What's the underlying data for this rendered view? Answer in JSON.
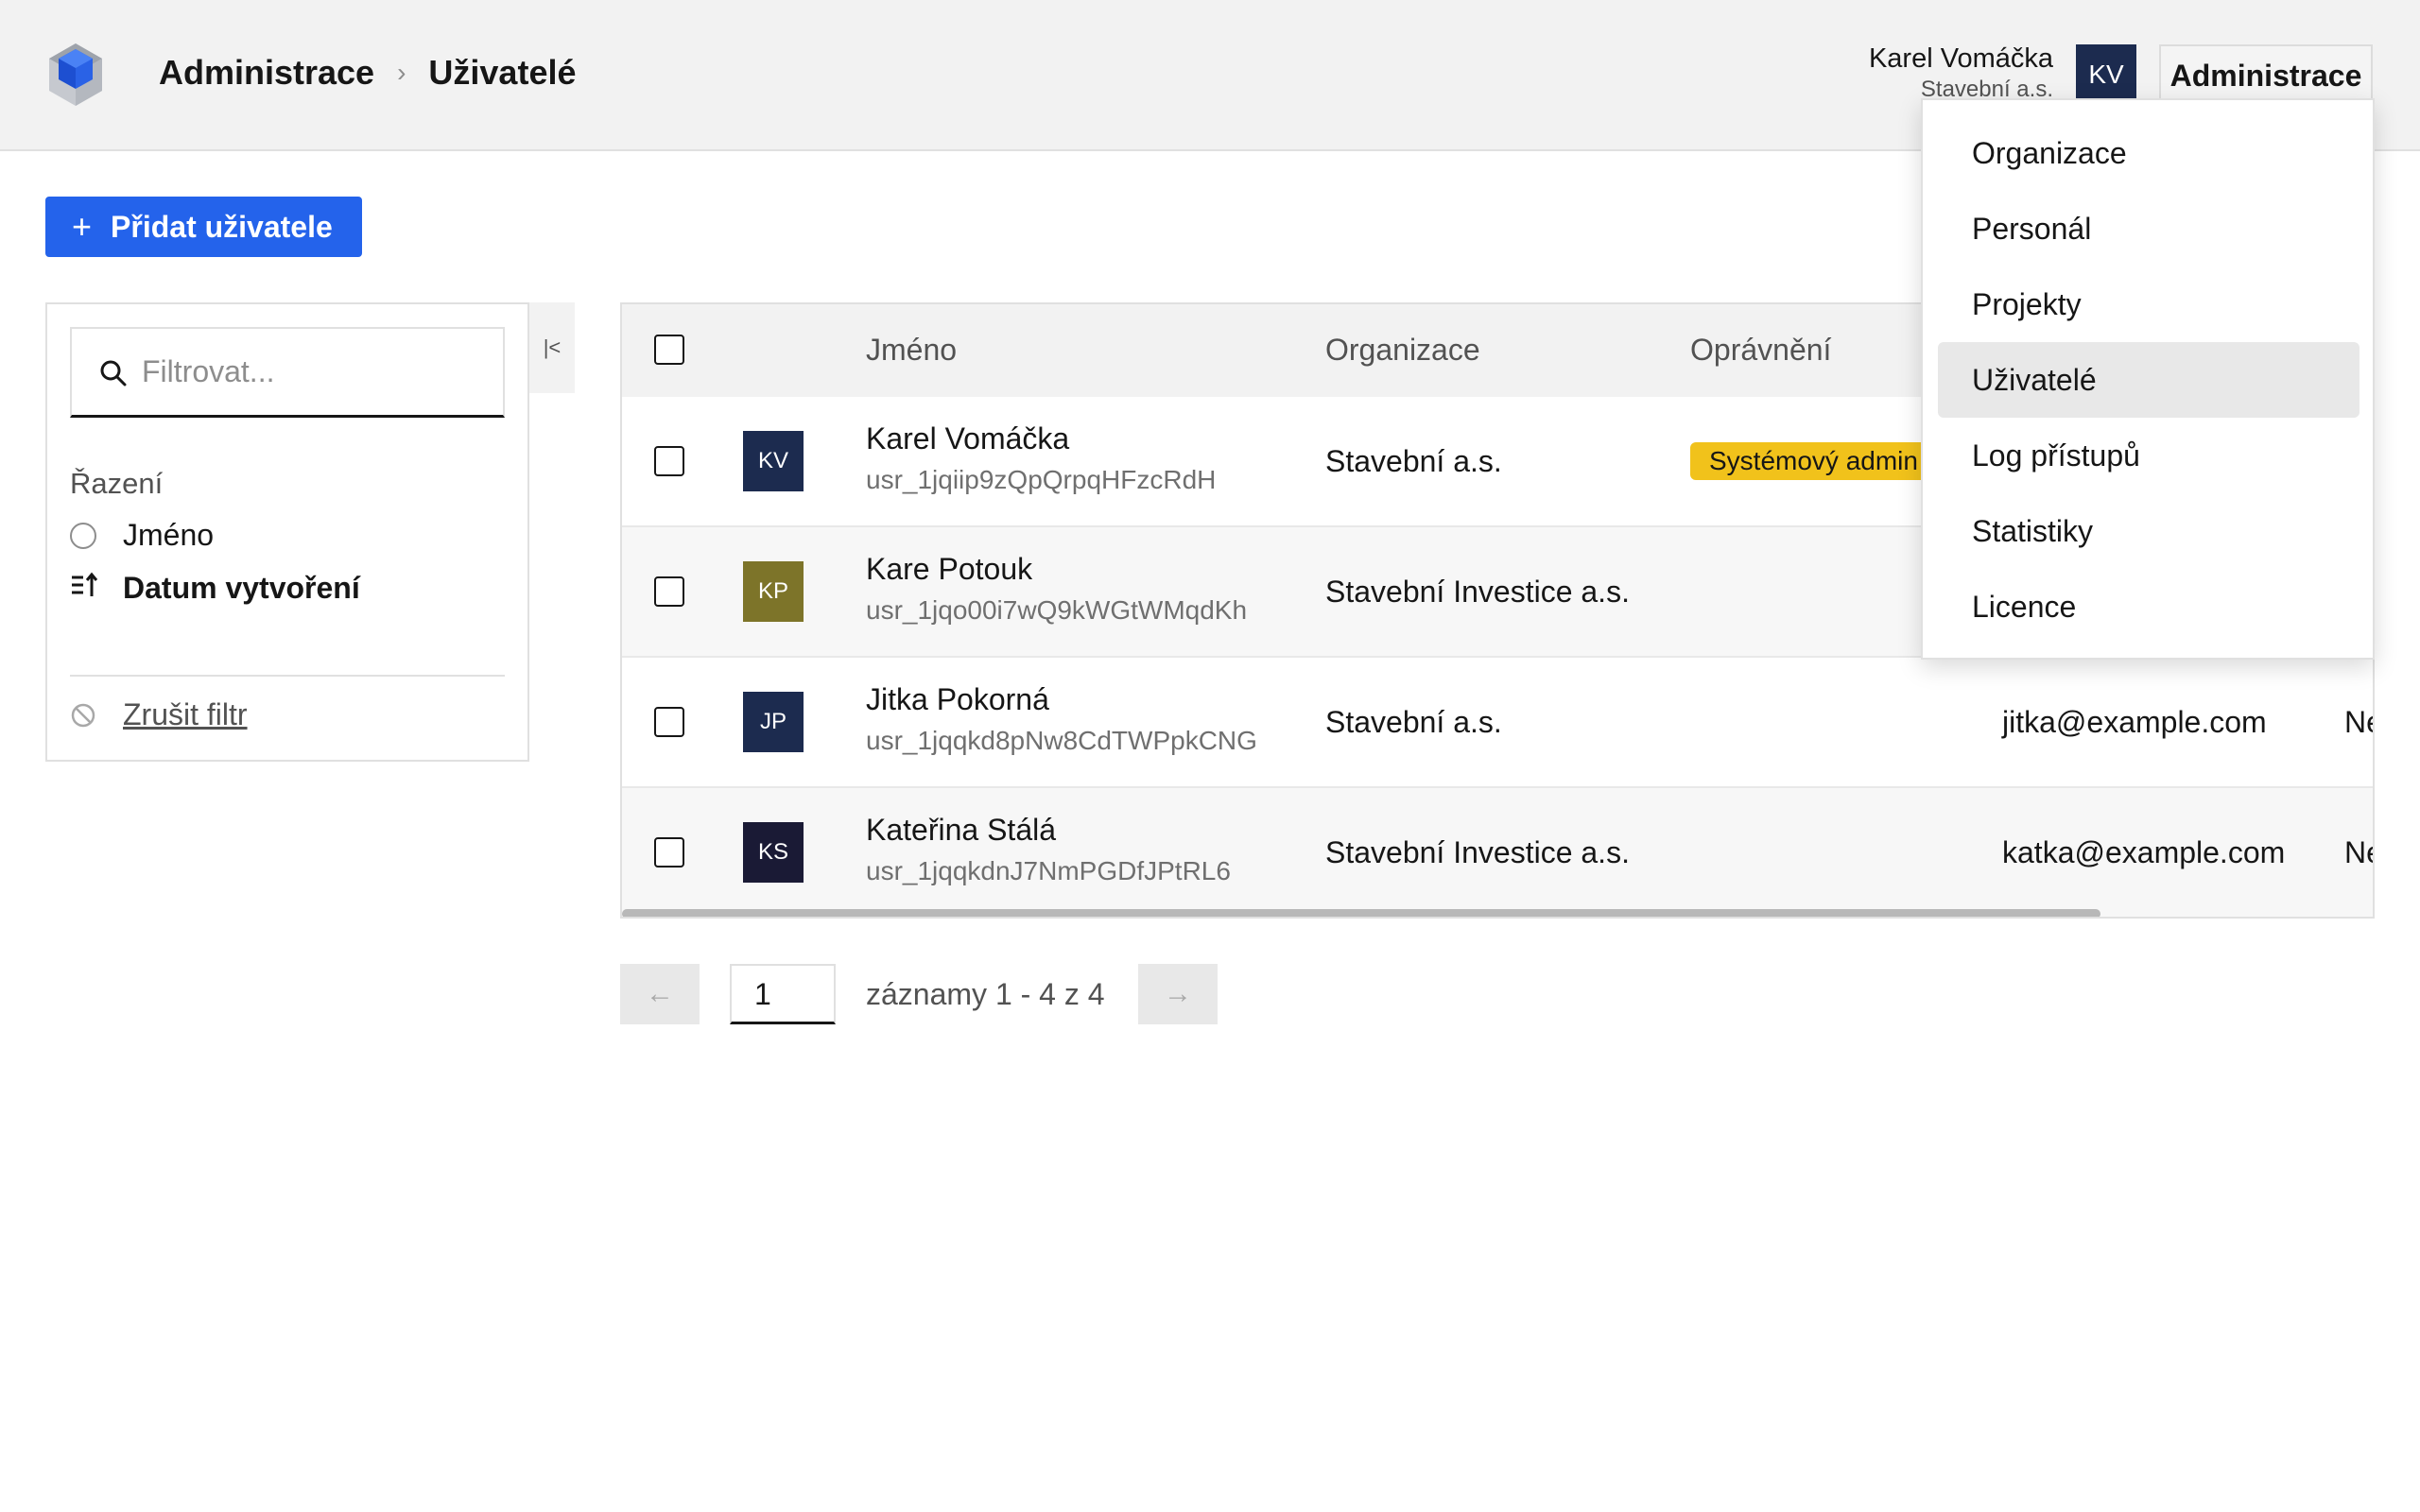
{
  "header": {
    "breadcrumb": [
      "Administrace",
      "Uživatelé"
    ],
    "user_name": "Karel Vomáčka",
    "user_org": "Stavební a.s.",
    "user_initials": "KV",
    "menu_button": "Administrace"
  },
  "toolbar": {
    "add_user_label": "Přidat uživatele"
  },
  "filter": {
    "search_placeholder": "Filtrovat...",
    "search_value": "",
    "sort_title": "Řazení",
    "sort_options": [
      {
        "label": "Jméno",
        "active": false
      },
      {
        "label": "Datum vytvoření",
        "active": true
      }
    ],
    "clear_label": "Zrušit filtr"
  },
  "table": {
    "headers": [
      "Jméno",
      "Organizace",
      "Oprávnění"
    ],
    "rows": [
      {
        "initials": "KV",
        "avatar_color": "#1c2b4f",
        "name": "Karel Vomáčka",
        "id": "usr_1jqiip9zQpQrpqHFzcRdH",
        "org": "Stavební a.s.",
        "permission": "Systémový admin",
        "email": "",
        "extra": ""
      },
      {
        "initials": "KP",
        "avatar_color": "#7d7429",
        "name": "Kare Potouk",
        "id": "usr_1jqo00i7wQ9kWGtWMqdKh",
        "org": "Stavební Investice a.s.",
        "permission": "",
        "email": "",
        "extra": ""
      },
      {
        "initials": "JP",
        "avatar_color": "#1c2b4f",
        "name": "Jitka Pokorná",
        "id": "usr_1jqqkd8pNw8CdTWPpkCNG",
        "org": "Stavební a.s.",
        "permission": "",
        "email": "jitka@example.com",
        "extra": "Ne"
      },
      {
        "initials": "KS",
        "avatar_color": "#1a1a35",
        "name": "Kateřina Stálá",
        "id": "usr_1jqqkdnJ7NmPGDfJPtRL6",
        "org": "Stavební Investice a.s.",
        "permission": "",
        "email": "katka@example.com",
        "extra": "Ne"
      }
    ]
  },
  "pagination": {
    "page": "1",
    "summary": "záznamy 1 - 4 z 4"
  },
  "dropdown": {
    "items": [
      {
        "label": "Organizace",
        "active": false
      },
      {
        "label": "Personál",
        "active": false
      },
      {
        "label": "Projekty",
        "active": false
      },
      {
        "label": "Uživatelé",
        "active": true
      },
      {
        "label": "Log přístupů",
        "active": false
      },
      {
        "label": "Statistiky",
        "active": false
      },
      {
        "label": "Licence",
        "active": false
      }
    ]
  },
  "colors": {
    "primary": "#2463eb",
    "badge_warning": "#f1c21b"
  }
}
